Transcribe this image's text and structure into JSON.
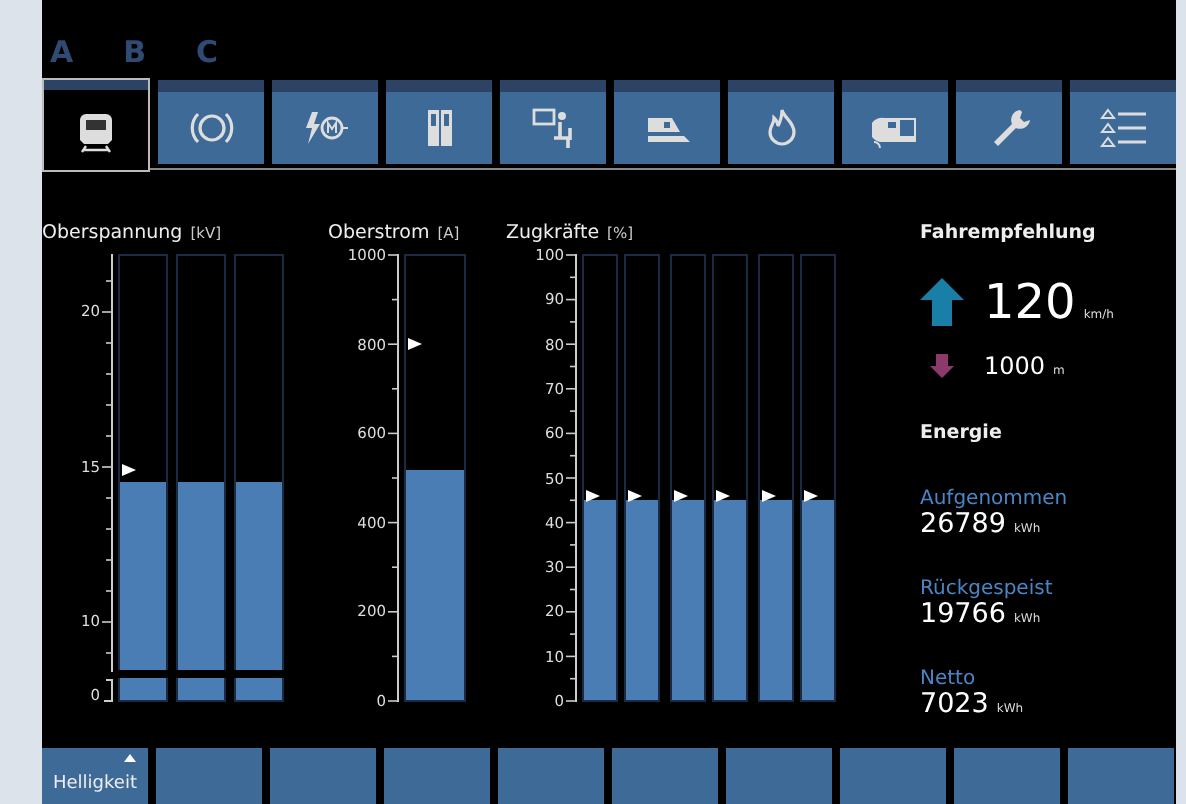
{
  "header_letters": [
    "A",
    "B",
    "C"
  ],
  "tabs": [
    {
      "selected": true
    },
    {
      "selected": false
    },
    {
      "selected": false
    },
    {
      "selected": false
    },
    {
      "selected": false
    },
    {
      "selected": false
    },
    {
      "selected": false
    },
    {
      "selected": false
    },
    {
      "selected": false
    },
    {
      "selected": false
    }
  ],
  "gauges": [
    {
      "title": "Oberspannung",
      "unit": "[kV]",
      "kind": "split",
      "ticks": [
        "20",
        "15",
        "10",
        "0"
      ],
      "bar_groups": [
        [
          {
            "level": 0.49,
            "marker": {
              "level": 0.52
            }
          },
          {
            "level": 0.49
          },
          {
            "level": 0.49
          }
        ]
      ]
    },
    {
      "title": "Oberstrom",
      "unit": "[A]",
      "kind": "linear",
      "ticks": [
        "1000",
        "800",
        "600",
        "400",
        "200",
        "0"
      ],
      "bar_groups": [
        [
          {
            "level": 0.52,
            "marker": {
              "level": 0.8
            }
          }
        ]
      ]
    },
    {
      "title": "Zugkräfte",
      "unit": "[%]",
      "kind": "linear",
      "ticks": [
        "100",
        "90",
        "80",
        "70",
        "60",
        "50",
        "40",
        "30",
        "20",
        "10",
        "0"
      ],
      "bar_groups": [
        [
          {
            "level": 0.45,
            "marker": {
              "level": 0.46
            }
          },
          {
            "level": 0.45,
            "marker": {
              "level": 0.46
            }
          }
        ],
        [
          {
            "level": 0.45,
            "marker": {
              "level": 0.46
            }
          },
          {
            "level": 0.45,
            "marker": {
              "level": 0.46
            }
          }
        ],
        [
          {
            "level": 0.45,
            "marker": {
              "level": 0.46
            }
          },
          {
            "level": 0.45,
            "marker": {
              "level": 0.46
            }
          }
        ]
      ]
    }
  ],
  "recommendation": {
    "title": "Fahrempfehlung",
    "items": [
      {
        "kind": "up",
        "value": "120",
        "unit": "km/h"
      },
      {
        "kind": "down",
        "value": "1000",
        "unit": "m"
      }
    ]
  },
  "energy": {
    "title": "Energie",
    "items": [
      {
        "label": "Aufgenommen",
        "value": "26789",
        "unit": "kWh"
      },
      {
        "label": "Rückgespeist",
        "value": "19766",
        "unit": "kWh"
      },
      {
        "label": "Netto",
        "value": "7023",
        "unit": "kWh"
      }
    ]
  },
  "soft_keys": [
    {
      "kind": "menu",
      "label": "Helligkeit"
    },
    {
      "kind": "blank"
    },
    {
      "kind": "blank"
    },
    {
      "kind": "blank"
    },
    {
      "kind": "blank"
    },
    {
      "kind": "blank"
    },
    {
      "kind": "blank"
    },
    {
      "kind": "blank"
    },
    {
      "kind": "blank"
    },
    {
      "kind": "blank"
    }
  ]
}
